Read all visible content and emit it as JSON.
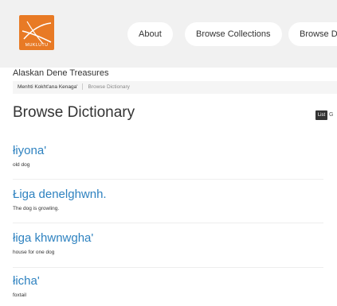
{
  "logo": {
    "text": "MUKLUTU",
    "icon": "muklutu-logo",
    "color": "#e87a25"
  },
  "nav": {
    "items": [
      {
        "label": "About"
      },
      {
        "label": "Browse Collections"
      },
      {
        "label": "Browse D"
      }
    ]
  },
  "site_title": "Alaskan Dene Treasures",
  "breadcrumb": {
    "home": "Menhti Kokht'ana Kenaga'",
    "current": "Browse Dictionary"
  },
  "page_title": "Browse Dictionary",
  "view_toggle": {
    "list_label": "List",
    "other_label": "G"
  },
  "entries": [
    {
      "word": "łiyona'",
      "definition": "old dog"
    },
    {
      "word": "Łiga denelghwnh.",
      "definition": "The dog is growling."
    },
    {
      "word": "łiga khwnwgha'",
      "definition": "house for one dog"
    },
    {
      "word": "łicha'",
      "definition": "foxtail"
    }
  ],
  "colors": {
    "link": "#2e82c0",
    "header_bg": "#f1f1f1",
    "breadcrumb_bg": "#f5f5f5"
  }
}
